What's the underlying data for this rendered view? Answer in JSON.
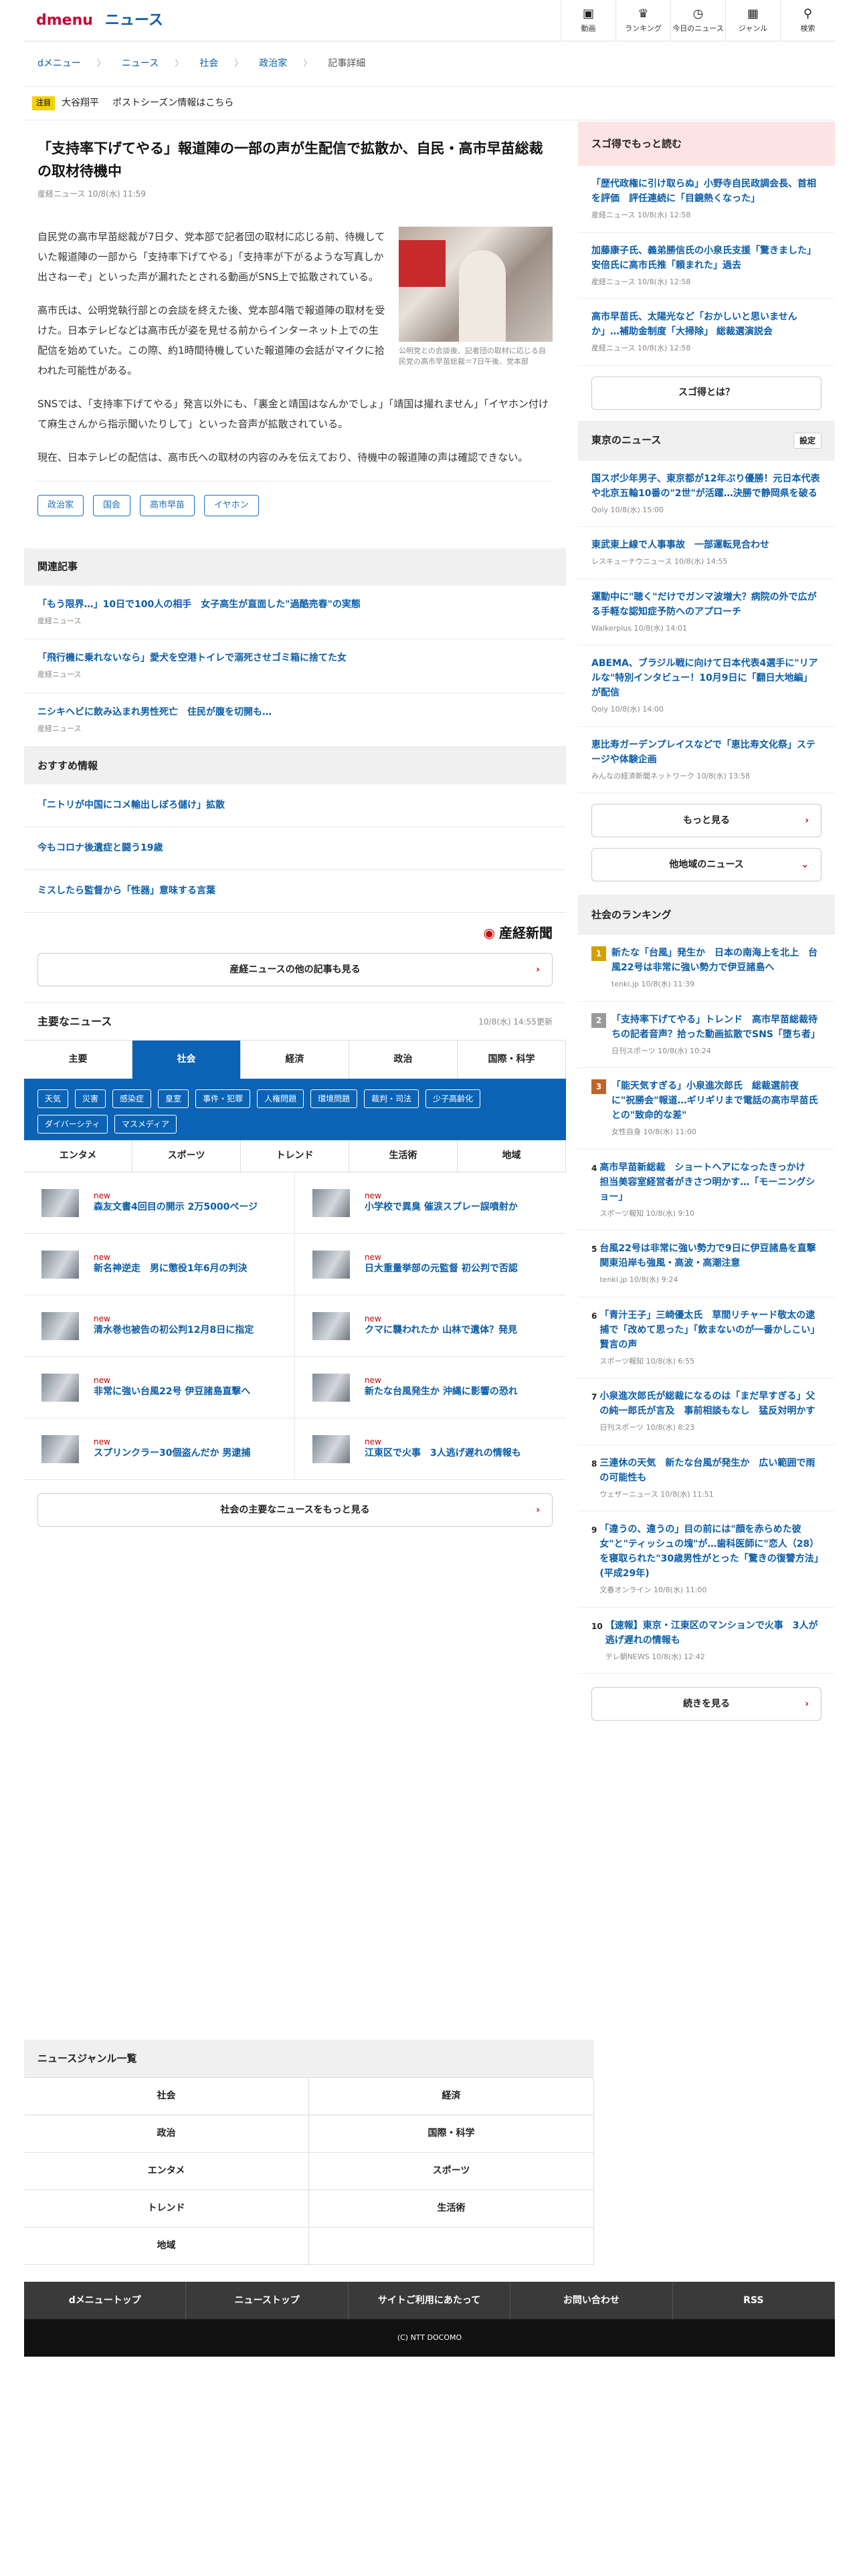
{
  "header": {
    "logo_d": "d",
    "logo_menu": "menu",
    "logo_news": "ニュース",
    "nav": [
      {
        "label": "動画",
        "icon": "video-icon"
      },
      {
        "label": "ランキング",
        "icon": "trophy-icon"
      },
      {
        "label": "今日のニュース",
        "icon": "clock-icon"
      },
      {
        "label": "ジャンル",
        "icon": "grid-icon"
      },
      {
        "label": "検索",
        "icon": "search-icon"
      }
    ]
  },
  "breadcrumb": [
    "dメニュー",
    "ニュース",
    "社会",
    "政治家",
    "記事詳細"
  ],
  "notice": {
    "tag": "注目",
    "item1": "大谷翔平",
    "item2": "ポストシーズン情報はこちら"
  },
  "article": {
    "title": "「支持率下げてやる」報道陣の一部の声が生配信で拡散か、自民・高市早苗総裁の取材待機中",
    "meta": "産経ニュース 10/8(水) 11:59",
    "photo_caption": "公明党との会談後、記者団の取材に応じる自民党の高市早苗総裁＝7日午後、党本部",
    "paragraphs": [
      "自民党の高市早苗総裁が7日夕、党本部で記者団の取材に応じる前、待機していた報道陣の一部から「支持率下げてやる」「支持率が下がるような写真しか出さねーぞ」といった声が漏れたとされる動画がSNS上で拡散されている。",
      "高市氏は、公明党執行部との会談を終えた後、党本部4階で報道陣の取材を受けた。日本テレビなどは高市氏が姿を見せる前からインターネット上での生配信を始めていた。この際、約1時間待機していた報道陣の会話がマイクに拾われた可能性がある。",
      "SNSでは、「支持率下げてやる」発言以外にも、「裏金と靖国はなんかでしょ」「靖国は撮れません」「イヤホン付けて麻生さんから指示聞いたりして」といった音声が拡散されている。",
      "現在、日本テレビの配信は、高市氏への取材の内容のみを伝えており、待機中の報道陣の声は確認できない。"
    ],
    "tags": [
      "政治家",
      "国会",
      "高市早苗",
      "イヤホン"
    ]
  },
  "related": {
    "heading": "関連記事",
    "items": [
      {
        "title": "「もう限界…」10日で100人の相手　女子高生が直面した\"過酷売春\"の実態",
        "source": "産経ニュース"
      },
      {
        "title": "「飛行機に乗れないなら」愛犬を空港トイレで溺死させゴミ箱に捨てた女",
        "source": "産経ニュース"
      },
      {
        "title": "ニシキヘビに飲み込まれ男性死亡　住民が腹を切開も…",
        "source": "産経ニュース"
      }
    ]
  },
  "recommended": {
    "heading": "おすすめ情報",
    "items": [
      "「ニトリが中国にコメ輸出しぼろ儲け」拡散",
      "今もコロナ後遺症と闘う19歳",
      "ミスしたら監督から「性器」意味する言葉"
    ]
  },
  "publisher": {
    "logo_text": "産経新聞",
    "more_button": "産経ニュースの他の記事も見る"
  },
  "major_news": {
    "heading": "主要なニュース",
    "timestamp": "10/8(水) 14:55更新",
    "tabs": [
      "主要",
      "社会",
      "経済",
      "政治",
      "国際・科学"
    ],
    "active_tab": 1,
    "subgenres": [
      "天気",
      "災害",
      "感染症",
      "皇室",
      "事件・犯罪",
      "人権問題",
      "環境問題",
      "裁判・司法",
      "少子高齢化",
      "ダイバーシティ",
      "マスメディア"
    ],
    "tabs2": [
      "エンタメ",
      "スポーツ",
      "トレンド",
      "生活術",
      "地域"
    ],
    "new_label": "new",
    "items": [
      "森友文書4回目の開示 2万5000ページ",
      "小学校で異臭 催涙スプレー誤噴射か",
      "新名神逆走　男に懲役1年6月の判決",
      "日大重量挙部の元監督 初公判で否認",
      "清水巻也被告の初公判12月8日に指定",
      "クマに襲われたか 山林で遺体？発見",
      "非常に強い台風22号 伊豆諸島直撃へ",
      "新たな台風発生か 沖縄に影響の恐れ",
      "スプリンクラー30個盗んだか 男逮捕",
      "江東区で火事　3人逃げ遅れの情報も"
    ],
    "more_button": "社会の主要なニュースをもっと見る"
  },
  "side": {
    "sugotoku": {
      "heading": "スゴ得でもっと読む",
      "items": [
        {
          "title": "「歴代政権に引け取らぬ」小野寺自民政調会長、首相を評価　評任連続に「目鏡熱くなった」",
          "source": "産経ニュース 10/8(水) 12:58"
        },
        {
          "title": "加藤康子氏、義弟勝信氏の小泉氏支援「驚きました」 安倍氏に高市氏推「頼まれた」過去",
          "source": "産経ニュース 10/8(水) 12:58"
        },
        {
          "title": "高市早苗氏、太陽光など「おかしいと思いませんか」…補助金制度「大掃除」 総裁選演説会",
          "source": "産経ニュース 10/8(水) 12:58"
        }
      ],
      "button": "スゴ得とは？"
    },
    "tokyo": {
      "heading": "東京のニュース",
      "settings": "設定",
      "items": [
        {
          "title": "国スポ少年男子、東京都が12年ぶり優勝！元日本代表や北京五輪10番の\"2世\"が活躍…決勝で静岡県を破る",
          "source": "Qoly 10/8(水) 15:00"
        },
        {
          "title": "東武東上線で人事事故　一部運転見合わせ",
          "source": "レスキューナウニュース 10/8(水) 14:55"
        },
        {
          "title": "運動中に\"聴く\"だけでガンマ波増大？病院の外で広がる手軽な認知症予防へのアプローチ",
          "source": "Walkerplus 10/8(水) 14:01"
        },
        {
          "title": "ABEMA、ブラジル戦に向けて日本代表4選手に\"リアルな\"特別インタビュー！10月9日に「翻日大地編」が配信",
          "source": "Qoly 10/8(水) 14:00"
        },
        {
          "title": "恵比寿ガーデンプレイスなどで「恵比寿文化祭」ステージや体験企画",
          "source": "みんなの経済新聞ネットワーク 10/8(水) 13:58"
        }
      ],
      "more_button": "もっと見る",
      "other_button": "他地域のニュース"
    },
    "ranking": {
      "heading": "社会のランキング",
      "items": [
        {
          "rank": "1",
          "title": "新たな「台風」発生か　日本の南海上を北上　台風22号は非常に強い勢力で伊豆諸島へ",
          "source": "tenki.jp 10/8(水) 11:39"
        },
        {
          "rank": "2",
          "title": "「支持率下げてやる」トレンド　高市早苗総裁待ちの記者音声？拾った動画拡散でSNS「堕ち者」",
          "source": "日刊スポーツ 10/8(水) 10:24"
        },
        {
          "rank": "3",
          "title": "「能天気すぎる」小泉進次郎氏　総裁選前夜に\"祝勝会\"報道…ギリギリまで電話の高市早苗氏との\"致命的な差\"",
          "source": "女性自身 10/8(水) 11:00"
        },
        {
          "rank": "4",
          "title": "高市早苗新総裁　ショートヘアになったきっかけ　担当美容室経営者がきさつ明かす…「モーニングショー」",
          "source": "スポーツ報知 10/8(水) 9:10"
        },
        {
          "rank": "5",
          "title": "台風22号は非常に強い勢力で9日に伊豆諸島を直撃　関東沿岸も強風・高波・高潮注意",
          "source": "tenki.jp 10/8(水) 9:24"
        },
        {
          "rank": "6",
          "title": "「青汁王子」三崎優太氏　草間リチャード敬太の逮捕で「改めて思った」「飲まないのが一番かしこい」賢言の声",
          "source": "スポーツ報知 10/8(水) 6:55"
        },
        {
          "rank": "7",
          "title": "小泉進次郎氏が総裁になるのは「まだ早すぎる」父の純一郎氏が言及　事前相談もなし　猛反対明かす",
          "source": "日刊スポーツ 10/8(水) 8:23"
        },
        {
          "rank": "8",
          "title": "三連休の天気　新たな台風が発生か　広い範囲で雨の可能性も",
          "source": "ウェザーニュース 10/8(水) 11:51"
        },
        {
          "rank": "9",
          "title": "「違うの、違うの」目の前には\"顔を赤らめた彼女\"と\"ティッシュの塊\"が…歯科医師に\"恋人（28）を寝取られた\"30歳男性がとった「驚きの復讐方法」(平成29年)",
          "source": "文春オンライン 10/8(水) 11:00"
        },
        {
          "rank": "10",
          "title": "【速報】東京・江東区のマンションで火事　3人が逃げ遅れの情報も",
          "source": "テレ朝NEWS 10/8(水) 12:42"
        }
      ],
      "button": "続きを見る"
    }
  },
  "genre_list": {
    "heading": "ニュースジャンル一覧",
    "items": [
      "社会",
      "経済",
      "政治",
      "国際・科学",
      "エンタメ",
      "スポーツ",
      "トレンド",
      "生活術",
      "地域"
    ]
  },
  "footer": {
    "links": [
      "dメニュートップ",
      "ニューストップ",
      "サイトご利用にあたって",
      "お問い合わせ",
      "RSS"
    ],
    "copyright": "(C) NTT DOCOMO"
  }
}
